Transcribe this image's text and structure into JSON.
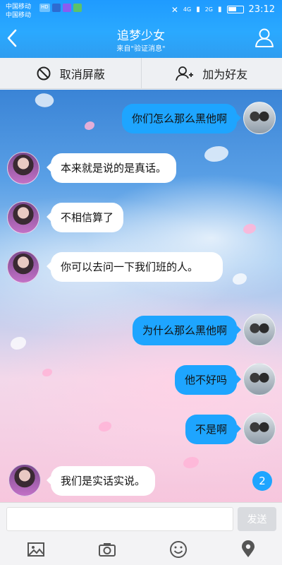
{
  "statusbar": {
    "carrier_primary": "中国移动",
    "carrier_secondary": "中国移动",
    "hd_badge": "HD",
    "net_left": "4G",
    "net_right": "2G",
    "time": "23:12"
  },
  "header": {
    "title": "追梦少女",
    "subtitle": "来自\"验证消息\"",
    "back_icon": "chevron-left-icon",
    "profile_icon": "person-icon"
  },
  "actions": {
    "unblock_label": "取消屏蔽",
    "add_friend_label": "加为好友"
  },
  "messages": [
    {
      "side": "out",
      "text": "你们怎么那么黑他啊"
    },
    {
      "side": "in",
      "text": "本来就是说的是真话。"
    },
    {
      "side": "in",
      "text": "不相信算了"
    },
    {
      "side": "in",
      "text": "你可以去问一下我们班的人。"
    },
    {
      "side": "out",
      "text": "为什么那么黑他啊"
    },
    {
      "side": "out",
      "text": "他不好吗"
    },
    {
      "side": "out",
      "text": "不是啊"
    },
    {
      "side": "in",
      "text": "我们是实话实说。"
    }
  ],
  "unread_count": "2",
  "composer": {
    "placeholder": "",
    "send_label": "发送"
  },
  "toolbar": [
    "image-icon",
    "camera-icon",
    "emoji-icon",
    "location-icon"
  ],
  "colors": {
    "header_blue": "#1f9bff",
    "bubble_out": "#1ea5ff",
    "bubble_in": "#ffffff"
  }
}
